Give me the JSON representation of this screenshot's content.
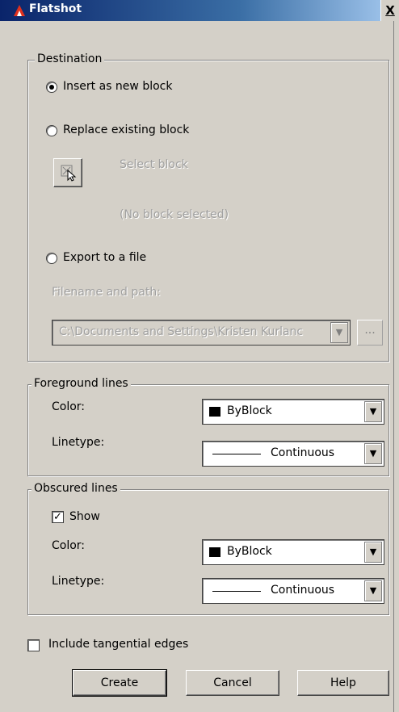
{
  "window": {
    "title": "Flatshot",
    "close_label": "X"
  },
  "destination": {
    "legend": "Destination",
    "insert_label": "Insert as new block",
    "replace_label": "Replace existing block",
    "select_block_label": "Select block",
    "no_block_label": "(No block selected)",
    "export_label": "Export to a file",
    "filename_label": "Filename and path:",
    "filename_value": "C:\\Documents and Settings\\Kristen Kurlanc",
    "browse_label": "...",
    "selected": "insert"
  },
  "foreground": {
    "legend": "Foreground lines",
    "color_label": "Color:",
    "color_value": "ByBlock",
    "linetype_label": "Linetype:",
    "linetype_value": "Continuous"
  },
  "obscured": {
    "legend": "Obscured lines",
    "show_label": "Show",
    "show_checked": true,
    "color_label": "Color:",
    "color_value": "ByBlock",
    "linetype_label": "Linetype:",
    "linetype_value": "Continuous"
  },
  "tangential": {
    "label": "Include tangential edges",
    "checked": false
  },
  "buttons": {
    "create": "Create",
    "cancel": "Cancel",
    "help": "Help"
  },
  "colors": {
    "titlebar_start": "#0a246a",
    "dialog_bg": "#d4d0c8"
  }
}
